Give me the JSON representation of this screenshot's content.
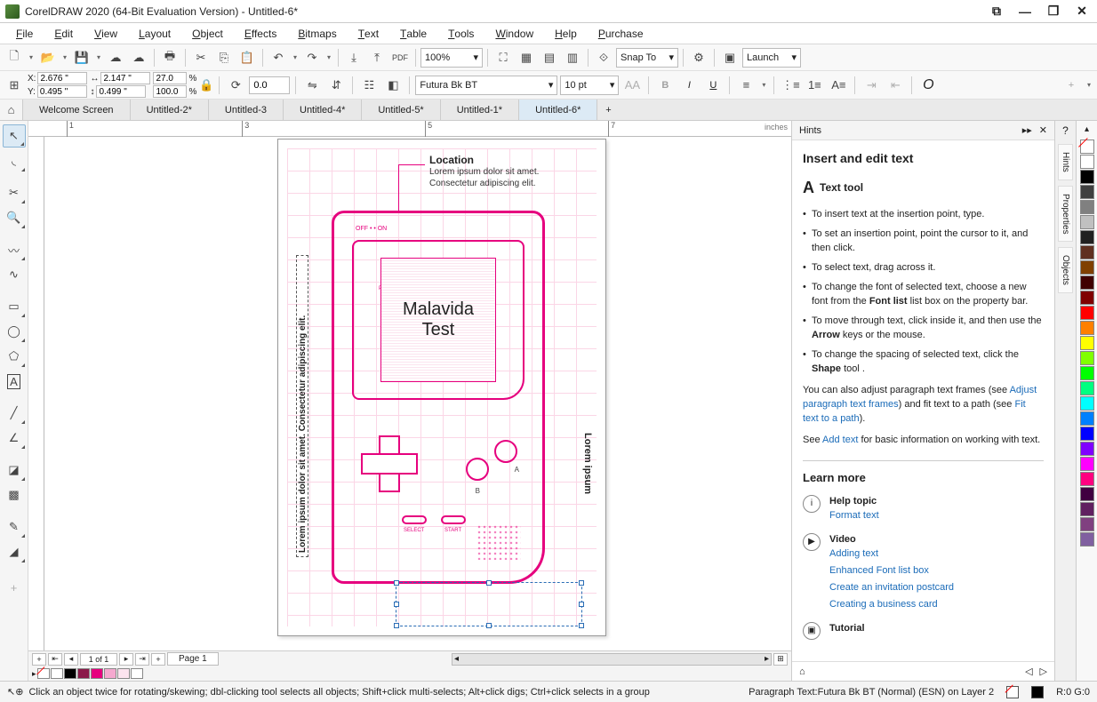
{
  "title": "CorelDRAW 2020 (64-Bit Evaluation Version) - Untitled-6*",
  "menus": [
    "File",
    "Edit",
    "View",
    "Layout",
    "Object",
    "Effects",
    "Bitmaps",
    "Text",
    "Table",
    "Tools",
    "Window",
    "Help",
    "Purchase"
  ],
  "toolbar1": {
    "zoom": "100%",
    "snap_label": "Snap To",
    "launch_label": "Launch"
  },
  "propbar": {
    "x": "2.676 \"",
    "y": "0.495 \"",
    "w": "2.147 \"",
    "h": "0.499 \"",
    "sx": "27.0",
    "sy": "100.0",
    "pct": "%",
    "rot": "0.0",
    "font": "Futura Bk BT",
    "size": "10 pt"
  },
  "doctabs": [
    "Welcome Screen",
    "Untitled-2*",
    "Untitled-3",
    "Untitled-4*",
    "Untitled-5*",
    "Untitled-1*",
    "Untitled-6*"
  ],
  "active_tab": 6,
  "ruler_unit": "inches",
  "ruler_marks": [
    "1",
    "3",
    "5",
    "7"
  ],
  "page_nav": {
    "pos": "1 of 1",
    "page_label": "Page 1"
  },
  "canvas": {
    "loc_h": "Location",
    "loc_t": "Lorem ipsum dolor sit amet. Consectetur adipiscing elit.",
    "screen_l1": "Malavida",
    "screen_l2": "Test",
    "onoff": "OFF • • ON",
    "power": "POWER",
    "side_l": "Lorem ipsum dolor sit amet. Consectetur adipiscing elit.",
    "side_r": "Lorem ipsum",
    "a": "A",
    "b": "B",
    "select": "SELECT",
    "start": "START"
  },
  "hints": {
    "panel_title": "Hints",
    "heading": "Insert and edit text",
    "tool_label": "Text tool",
    "bullets": [
      "To insert text at the insertion point, type.",
      "To set an insertion point, point the cursor to it, and then click.",
      "To select text, drag across it.",
      "To change the font of selected text, choose a new font from the Font list list box on the property bar.",
      "To move through text, click inside it, and then use the Arrow keys or the mouse.",
      "To change the spacing of selected text, click the Shape tool ."
    ],
    "para1a": "You can also adjust paragraph text frames (see ",
    "para1_link": "Adjust paragraph text frames",
    "para1b": ") and fit text to a path (see ",
    "para1_link2": "Fit text to a path",
    "para1c": ").",
    "para2a": "See ",
    "para2_link": "Add text",
    "para2b": " for basic information on working with text.",
    "learn_more": "Learn more",
    "help_h": "Help topic",
    "help_links": [
      "Format text"
    ],
    "video_h": "Video",
    "video_links": [
      "Adding text",
      "Enhanced Font list box",
      "Create an invitation postcard",
      "Creating a business card"
    ],
    "tutorial_h": "Tutorial"
  },
  "rail_tabs": [
    "Hints",
    "Properties",
    "Objects"
  ],
  "palette": [
    "#ffffff",
    "#000000",
    "#404040",
    "#808080",
    "#c0c0c0",
    "#202020",
    "#603020",
    "#804000",
    "#400000",
    "#800000",
    "#ff0000",
    "#ff8000",
    "#ffff00",
    "#80ff00",
    "#00ff00",
    "#00ff80",
    "#00ffff",
    "#0080ff",
    "#0000ff",
    "#8000ff",
    "#ff00ff",
    "#ff0080",
    "#400040",
    "#602060",
    "#804080",
    "#8060a0"
  ],
  "doc_palette": [
    "#ffffff",
    "#000000",
    "#8b1a4a",
    "#e6007e",
    "#f5a8cf",
    "#fce4ef",
    "#ffffff"
  ],
  "status": {
    "hint": "Click an object twice for rotating/skewing; dbl-clicking tool selects all objects; Shift+click multi-selects; Alt+click digs; Ctrl+click selects in a group",
    "obj": "Paragraph Text:Futura Bk BT (Normal) (ESN) on Layer 2",
    "fill": "R:0 G:0"
  }
}
